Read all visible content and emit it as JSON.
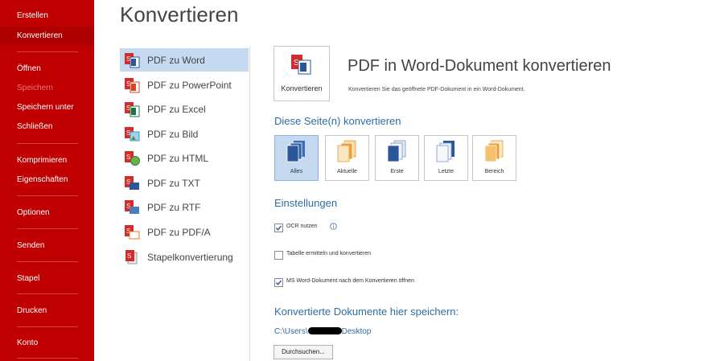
{
  "sidebar": {
    "items": [
      {
        "label": "Erstellen"
      },
      {
        "label": "Konvertieren"
      },
      {
        "label": "Öffnen"
      },
      {
        "label": "Speichern"
      },
      {
        "label": "Speichern unter"
      },
      {
        "label": "Schließen"
      },
      {
        "label": "Komprimieren"
      },
      {
        "label": "Eigenschaften"
      },
      {
        "label": "Optionen"
      },
      {
        "label": "Senden"
      },
      {
        "label": "Stapel"
      },
      {
        "label": "Drucken"
      },
      {
        "label": "Konto"
      }
    ]
  },
  "page_title": "Konvertieren",
  "formats": [
    {
      "label": "PDF zu Word",
      "icon": "pdf-to-word-icon"
    },
    {
      "label": "PDF zu PowerPoint",
      "icon": "pdf-to-powerpoint-icon"
    },
    {
      "label": "PDF zu Excel",
      "icon": "pdf-to-excel-icon"
    },
    {
      "label": "PDF zu Bild",
      "icon": "pdf-to-image-icon"
    },
    {
      "label": "PDF zu HTML",
      "icon": "pdf-to-html-icon"
    },
    {
      "label": "PDF zu TXT",
      "icon": "pdf-to-txt-icon"
    },
    {
      "label": "PDF zu RTF",
      "icon": "pdf-to-rtf-icon"
    },
    {
      "label": "PDF zu PDF/A",
      "icon": "pdf-to-pdfa-icon"
    },
    {
      "label": "Stapelkonvertierung",
      "icon": "batch-convert-icon"
    }
  ],
  "main": {
    "convert_button": "Konvertieren",
    "heading": "PDF in Word-Dokument konvertieren",
    "description": "Konvertieren Sie das geöffnete PDF-Dokument in ein Word-Dokument."
  },
  "pages_section": {
    "title": "Diese Seite(n) konvertieren",
    "options": [
      {
        "label": "Alles"
      },
      {
        "label": "Aktuelle"
      },
      {
        "label": "Erste"
      },
      {
        "label": "Letzte"
      },
      {
        "label": "Bereich"
      }
    ]
  },
  "settings": {
    "title": "Einstellungen",
    "ocr": {
      "label": "OCR nutzen",
      "checked": true
    },
    "table": {
      "label": "Tabelle ermitteln und konvertieren",
      "checked": false
    },
    "open_word": {
      "label": "MS Word-Dokument nach dem Konvertieren öffnen",
      "checked": true
    }
  },
  "save": {
    "title": "Konvertierte Dokumente hier speichern:",
    "path_prefix": "C:\\Users\\",
    "path_suffix": "Desktop",
    "browse": "Durchsuchen..."
  },
  "colors": {
    "sidebar": "#c00000",
    "sidebar_active": "#ae0000",
    "accent_blue": "#2e6da4",
    "selected_bg": "#c5d9f1"
  }
}
